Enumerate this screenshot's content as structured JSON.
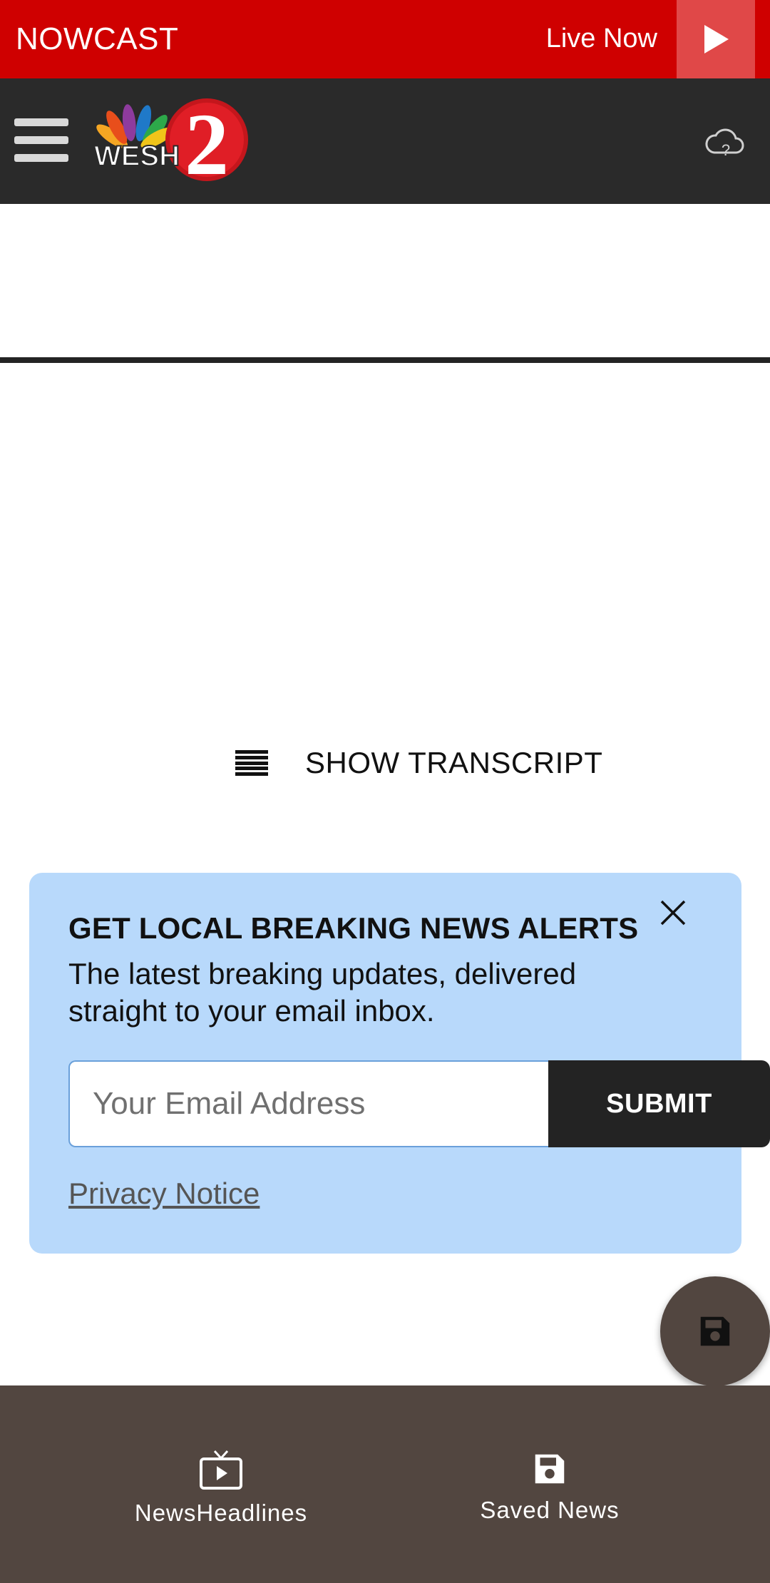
{
  "nowcast_bar": {
    "title": "NOWCAST",
    "live_label": "Live Now",
    "play_icon": "play-icon",
    "background_color": "#cf0000"
  },
  "header": {
    "menu_icon": "hamburger-menu-icon",
    "logo_alt": "WESH 2",
    "weather_icon": "cloud-question-icon",
    "background_color": "#2a2a2a"
  },
  "transcript": {
    "label": "SHOW TRANSCRIPT",
    "icon": "transcript-lines-icon"
  },
  "alert_card": {
    "title": "GET LOCAL BREAKING NEWS ALERTS",
    "description": "The latest breaking updates, delivered straight to your email inbox.",
    "email_placeholder": "Your Email Address",
    "email_value": "",
    "submit_label": "SUBMIT",
    "privacy_label": "Privacy Notice",
    "close_icon": "close-icon",
    "background_color": "#b8d9fb"
  },
  "fab": {
    "icon": "floppy-disk-icon"
  },
  "bottom_nav": {
    "items": [
      {
        "label": "NewsHeadlines",
        "icon": "tv-play-icon"
      },
      {
        "label": "Saved News",
        "icon": "floppy-disk-icon"
      }
    ],
    "background_color": "#524640"
  }
}
